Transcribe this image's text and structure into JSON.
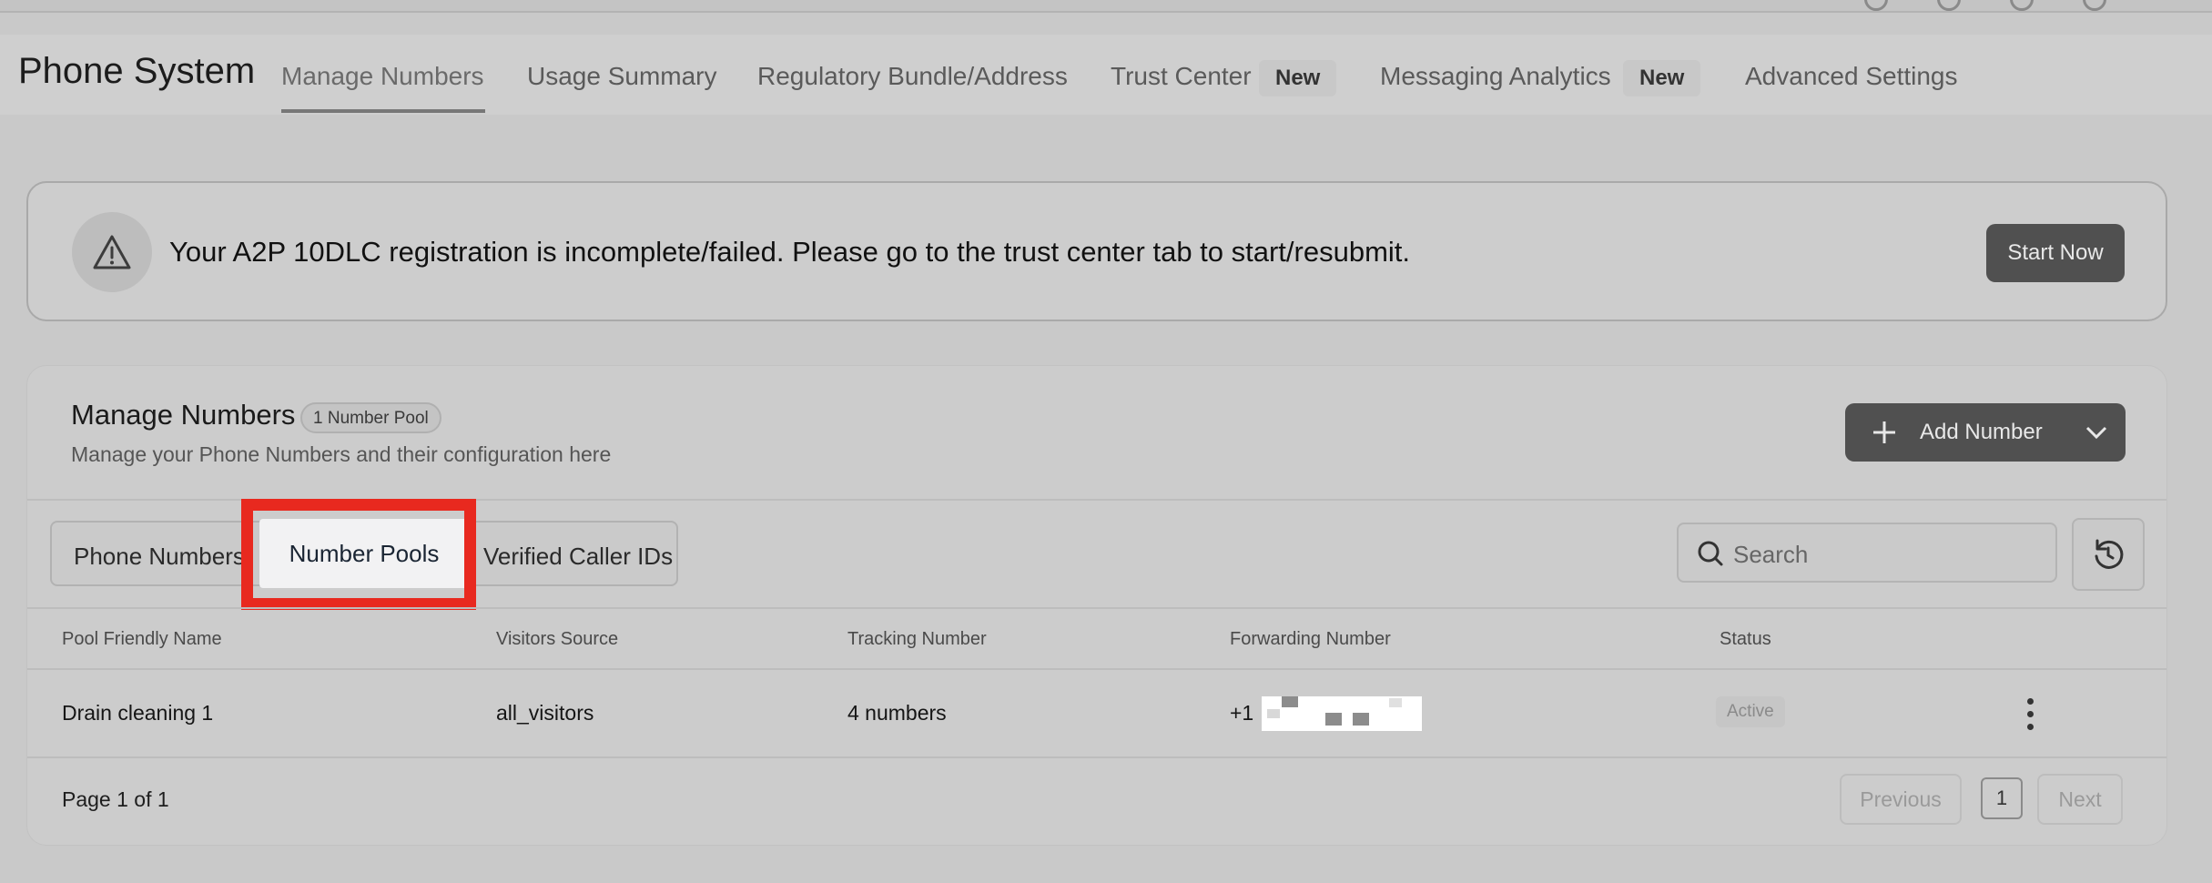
{
  "header": {
    "app_title": "Phone System",
    "tabs": [
      {
        "label": "Manage Numbers"
      },
      {
        "label": "Usage Summary"
      },
      {
        "label": "Regulatory Bundle/Address"
      },
      {
        "label": "Trust Center",
        "badge": "New"
      },
      {
        "label": "Messaging Analytics",
        "badge": "New"
      },
      {
        "label": "Advanced Settings"
      }
    ],
    "active_tab": "Manage Numbers"
  },
  "alert": {
    "icon": "warning-triangle-icon",
    "message": "Your A2P 10DLC registration is incomplete/failed. Please go to the trust center tab to start/resubmit.",
    "action_label": "Start Now"
  },
  "card": {
    "title": "Manage Numbers",
    "count_pill": "1 Number Pool",
    "subtitle": "Manage your Phone Numbers and their configuration here",
    "add_button_label": "Add Number",
    "subtabs": [
      {
        "label": "Phone Numbers"
      },
      {
        "label": "Number Pools"
      },
      {
        "label": "Verified Caller IDs"
      }
    ],
    "active_subtab": "Number Pools",
    "search_placeholder": "Search",
    "table": {
      "columns": [
        "Pool Friendly Name",
        "Visitors Source",
        "Tracking Number",
        "Forwarding Number",
        "Status"
      ],
      "rows": [
        {
          "name": "Drain cleaning 1",
          "source": "all_visitors",
          "tracking": "4 numbers",
          "forwarding_prefix": "+1",
          "status": "Active"
        }
      ]
    },
    "pagination": {
      "info": "Page 1 of 1",
      "previous": "Previous",
      "current": "1",
      "next": "Next"
    }
  },
  "colors": {
    "highlight": "#e8291f",
    "dark_button": "#505050",
    "background": "#c9c9c9"
  }
}
